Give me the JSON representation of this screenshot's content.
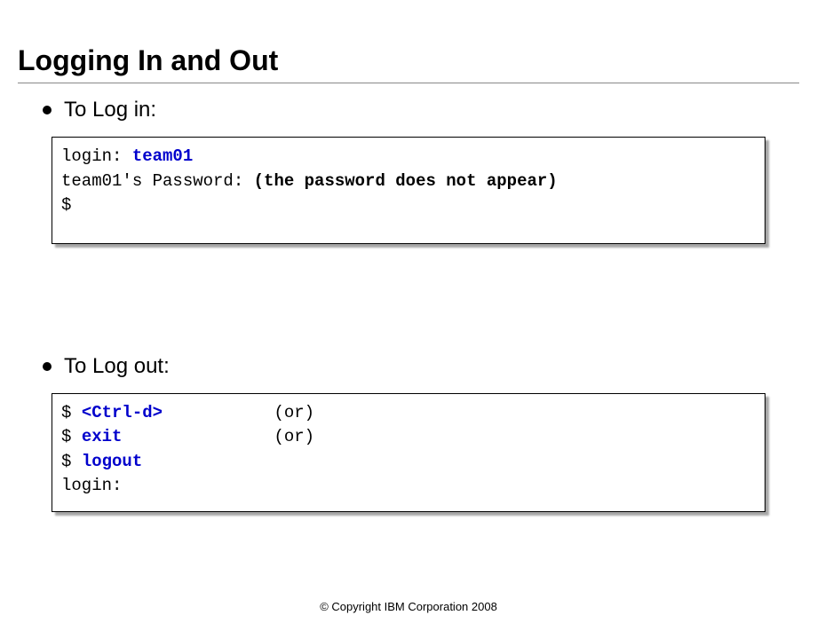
{
  "title": "Logging In and Out",
  "bullet1": "To Log in:",
  "bullet2": "To Log out:",
  "terminal1": {
    "line1a": "login: ",
    "line1b": "team01",
    "line2a": "team01's Password: ",
    "line2b": "(the password does not appear)",
    "line3": "$"
  },
  "terminal2": {
    "prompt": "$ ",
    "cmd1": "<Ctrl-d>",
    "cmd1_suffix": "           (or)",
    "cmd2": "exit",
    "cmd2_suffix": "               (or)",
    "cmd3": "logout",
    "line4": "login:"
  },
  "footer": "© Copyright IBM Corporation 2008"
}
